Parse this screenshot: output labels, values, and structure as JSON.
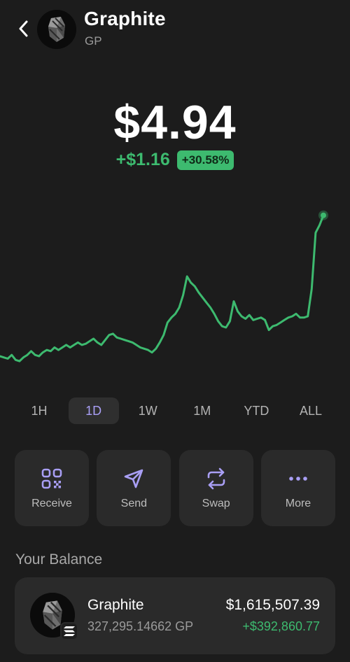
{
  "token": {
    "name": "Graphite",
    "symbol": "GP"
  },
  "price": {
    "value": "$4.94",
    "change_abs": "+$1.16",
    "change_pct": "+30.58%"
  },
  "chart_data": {
    "type": "line",
    "color": "#3dba6f",
    "values": [
      3.81,
      3.8,
      3.79,
      3.82,
      3.78,
      3.77,
      3.8,
      3.82,
      3.85,
      3.82,
      3.81,
      3.84,
      3.86,
      3.85,
      3.88,
      3.86,
      3.88,
      3.9,
      3.88,
      3.9,
      3.92,
      3.9,
      3.91,
      3.93,
      3.95,
      3.92,
      3.9,
      3.94,
      3.98,
      3.99,
      3.96,
      3.95,
      3.94,
      3.93,
      3.92,
      3.9,
      3.88,
      3.87,
      3.86,
      3.84,
      3.87,
      3.92,
      3.98,
      4.08,
      4.12,
      4.15,
      4.2,
      4.3,
      4.45,
      4.4,
      4.37,
      4.32,
      4.28,
      4.24,
      4.2,
      4.15,
      4.09,
      4.05,
      4.04,
      4.09,
      4.25,
      4.17,
      4.13,
      4.11,
      4.14,
      4.1,
      4.11,
      4.12,
      4.1,
      4.02,
      4.05,
      4.06,
      4.08,
      4.1,
      4.12,
      4.13,
      4.15,
      4.12,
      4.12,
      4.13,
      4.35,
      4.8,
      4.86,
      4.94
    ],
    "x_range": [
      0,
      83
    ],
    "y_range": [
      3.72,
      5.0
    ]
  },
  "ranges": [
    "1H",
    "1D",
    "1W",
    "1M",
    "YTD",
    "ALL"
  ],
  "active_range": "1D",
  "actions": [
    {
      "label": "Receive",
      "icon": "qr-code-icon"
    },
    {
      "label": "Send",
      "icon": "send-icon"
    },
    {
      "label": "Swap",
      "icon": "swap-icon"
    },
    {
      "label": "More",
      "icon": "more-icon"
    }
  ],
  "balance": {
    "title": "Your Balance",
    "name": "Graphite",
    "amount": "327,295.14662 GP",
    "value": "$1,615,507.39",
    "change": "+$392,860.77",
    "chain_icon": "solana-icon"
  },
  "colors": {
    "background": "#1c1c1c",
    "positive": "#3dba6f",
    "accent": "#a99ff5",
    "card": "#2a2a2a"
  }
}
